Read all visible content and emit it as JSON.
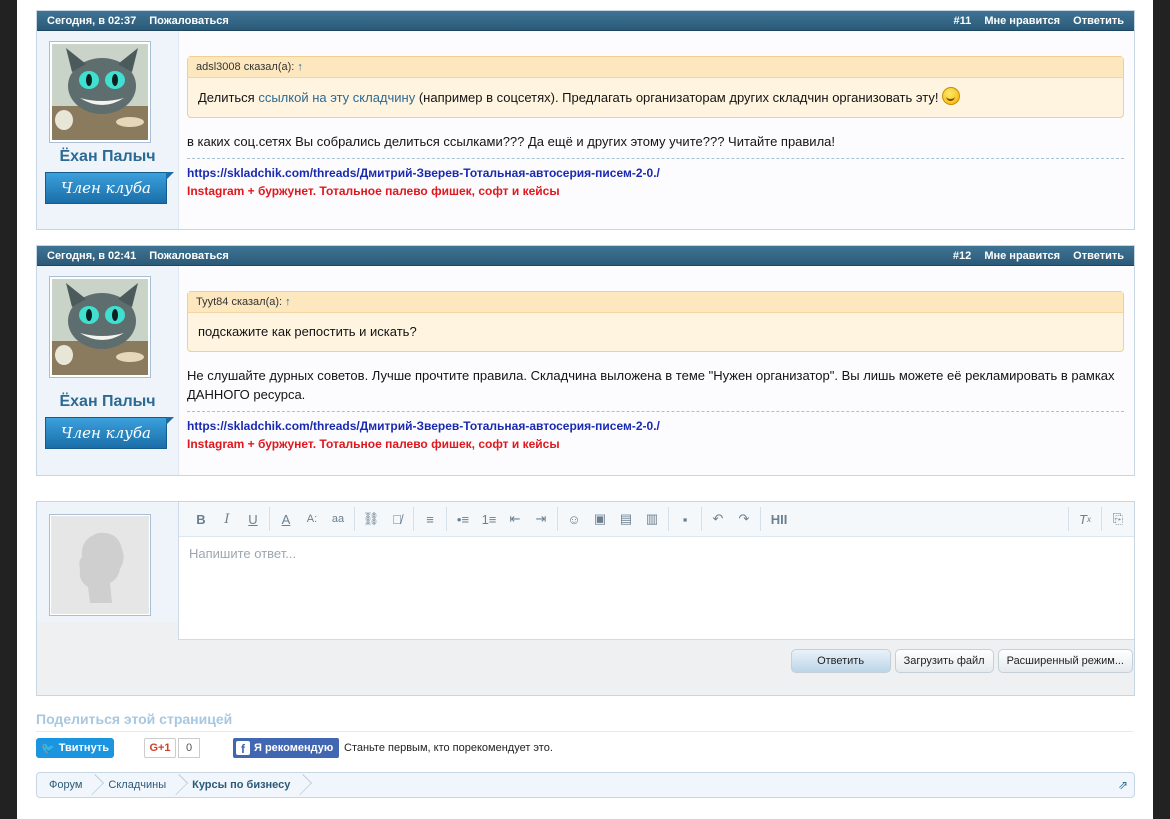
{
  "posts": [
    {
      "date": "Сегодня, в 02:37",
      "report": "Пожаловаться",
      "number": "#11",
      "like": "Мне нравится",
      "reply": "Ответить",
      "username": "Ёхан Палыч",
      "user_title": "Член клуба",
      "quote": {
        "author": "adsl3008 сказал(а):",
        "arrow": "↑",
        "text_before": "Делиться ",
        "link": "ссылкой на эту складчину",
        "text_after": " (например в соцсетях). Предлагать организаторам других складчин организовать эту! "
      },
      "text": "в каких соц.сетях Вы собрались делиться ссылками??? Да ещё и других этому учите??? Читайте правила!",
      "sig_link": "https://skladchik.com/threads/Дмитрий-Зверев-Тотальная-автосерия-писем-2-0./",
      "sig_promo": "Instagram + буржунет. Тотальное палево фишек, софт и кейсы"
    },
    {
      "date": "Сегодня, в 02:41",
      "report": "Пожаловаться",
      "number": "#12",
      "like": "Мне нравится",
      "reply": "Ответить",
      "username": "Ёхан Палыч",
      "user_title": "Член клуба",
      "quote": {
        "author": "Tyyt84 сказал(а):",
        "arrow": "↑",
        "text": "подскажите как репостить и искать?"
      },
      "text": "Не слушайте дурных советов. Лучше прочтите правила. Складчина выложена в теме \"Нужен организатор\". Вы лишь можете её рекламировать в рамках ДАННОГО ресурса.",
      "sig_link": "https://skladchik.com/threads/Дмитрий-Зверев-Тотальная-автосерия-писем-2-0./",
      "sig_promo": "Instagram + буржунет. Тотальное палево фишек, софт и кейсы"
    }
  ],
  "editor": {
    "placeholder": "Напишите ответ...",
    "toolbar": [
      "B",
      "I",
      "U",
      "A",
      "A:",
      "aa",
      "link",
      "unlink",
      "align",
      "ul",
      "ol",
      "outdent",
      "indent",
      "smile",
      "image",
      "media",
      "quote",
      "save",
      "undo",
      "redo",
      "H"
    ],
    "btn_reply": "Ответить",
    "btn_upload": "Загрузить файл",
    "btn_advanced": "Расширенный режим..."
  },
  "share": {
    "title": "Поделиться этой страницей",
    "twitter": "Твитнуть",
    "gplus": "G+1",
    "gplus_count": "0",
    "facebook": "Я рекомендую",
    "facebook_text": "Станьте первым, кто порекомендует это."
  },
  "breadcrumbs": [
    "Форум",
    "Складчины",
    "Курсы по бизнесу"
  ],
  "colors": {
    "header": "#2b5a78",
    "accent": "#2b6a93",
    "promo": "#e0171c",
    "link": "#1a2ab0"
  }
}
